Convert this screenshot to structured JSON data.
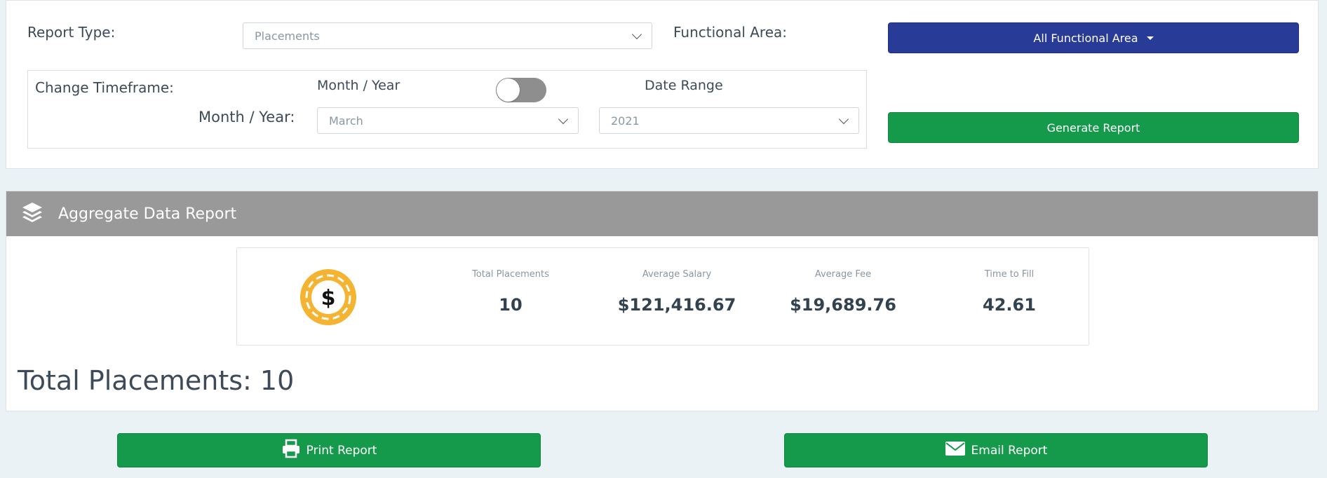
{
  "filters": {
    "report_type_label": "Report Type:",
    "report_type_value": "Placements",
    "functional_area_label": "Functional Area:",
    "functional_area_button": "All Functional Area",
    "timeframe_label": "Change Timeframe:",
    "toggle_left_label": "Month / Year",
    "toggle_right_label": "Date Range",
    "month_year_label": "Month / Year:",
    "month_value": "March",
    "year_value": "2021",
    "generate_button": "Generate Report"
  },
  "report": {
    "title": "Aggregate Data Report",
    "stats": [
      {
        "label": "Total Placements",
        "value": "10"
      },
      {
        "label": "Average Salary",
        "value": "$121,416.67"
      },
      {
        "label": "Average Fee",
        "value": "$19,689.76"
      },
      {
        "label": "Time to Fill",
        "value": "42.61"
      }
    ],
    "total_text": "Total Placements: 10"
  },
  "actions": {
    "print_label": "Print Report",
    "email_label": "Email Report"
  },
  "icons": {
    "header": "layers-icon",
    "chip": "dollar-chip-icon",
    "print": "printer-icon",
    "email": "envelope-icon"
  },
  "colors": {
    "primary_blue": "#283b96",
    "success_green": "#15994a",
    "header_gray": "#999999",
    "chip_orange": "#f5b332"
  }
}
